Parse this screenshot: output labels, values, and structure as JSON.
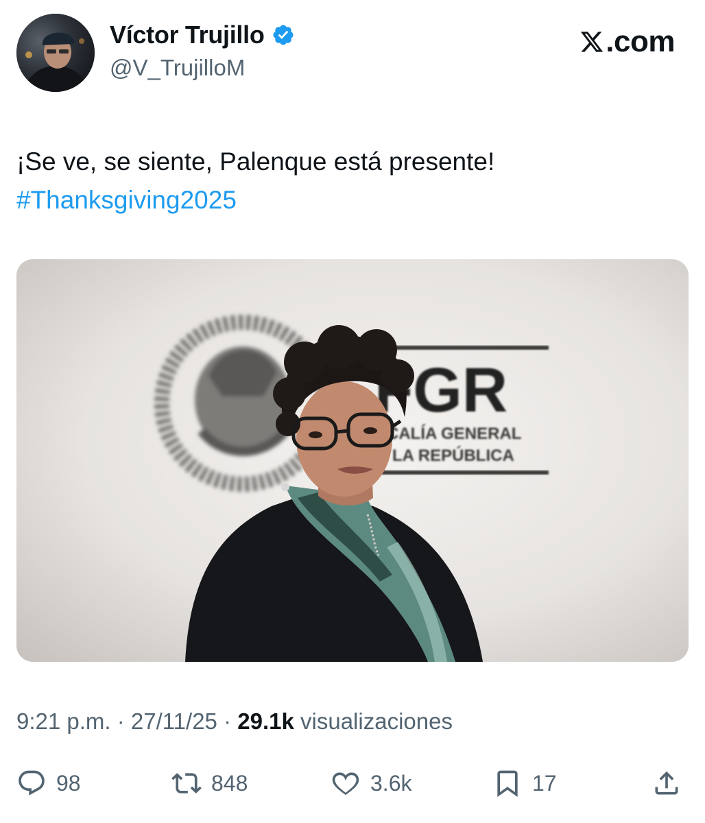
{
  "author": {
    "display_name": "Víctor Trujillo",
    "handle": "@V_TrujilloM",
    "verified": true,
    "avatar_icon": "profile-photo"
  },
  "brand": {
    "site_label": ".com",
    "logo_icon": "x-logo-icon"
  },
  "tweet": {
    "text": "¡Se ve, se siente, Palenque está presente!",
    "hashtag": "#Thanksgiving2025",
    "hashtag_color": "#1d9bf0"
  },
  "media": {
    "description_icon": "photo",
    "sign": {
      "fgr": "FGR",
      "line1": "CALÍA GENERAL",
      "line2": "LA REPÚBLICA"
    }
  },
  "meta": {
    "time": "9:21 p.m.",
    "sep1": " · ",
    "date": "27/11/25",
    "sep2": " · ",
    "views_count": "29.1k",
    "views_label": " visualizaciones"
  },
  "actions": {
    "reply": {
      "icon": "reply-icon",
      "count": "98"
    },
    "retweet": {
      "icon": "retweet-icon",
      "count": "848"
    },
    "like": {
      "icon": "heart-icon",
      "count": "3.6k"
    },
    "bookmark": {
      "icon": "bookmark-icon",
      "count": "17"
    },
    "share": {
      "icon": "share-icon"
    }
  },
  "colors": {
    "text": "#0f1419",
    "secondary": "#536471",
    "accent": "#1d9bf0"
  }
}
